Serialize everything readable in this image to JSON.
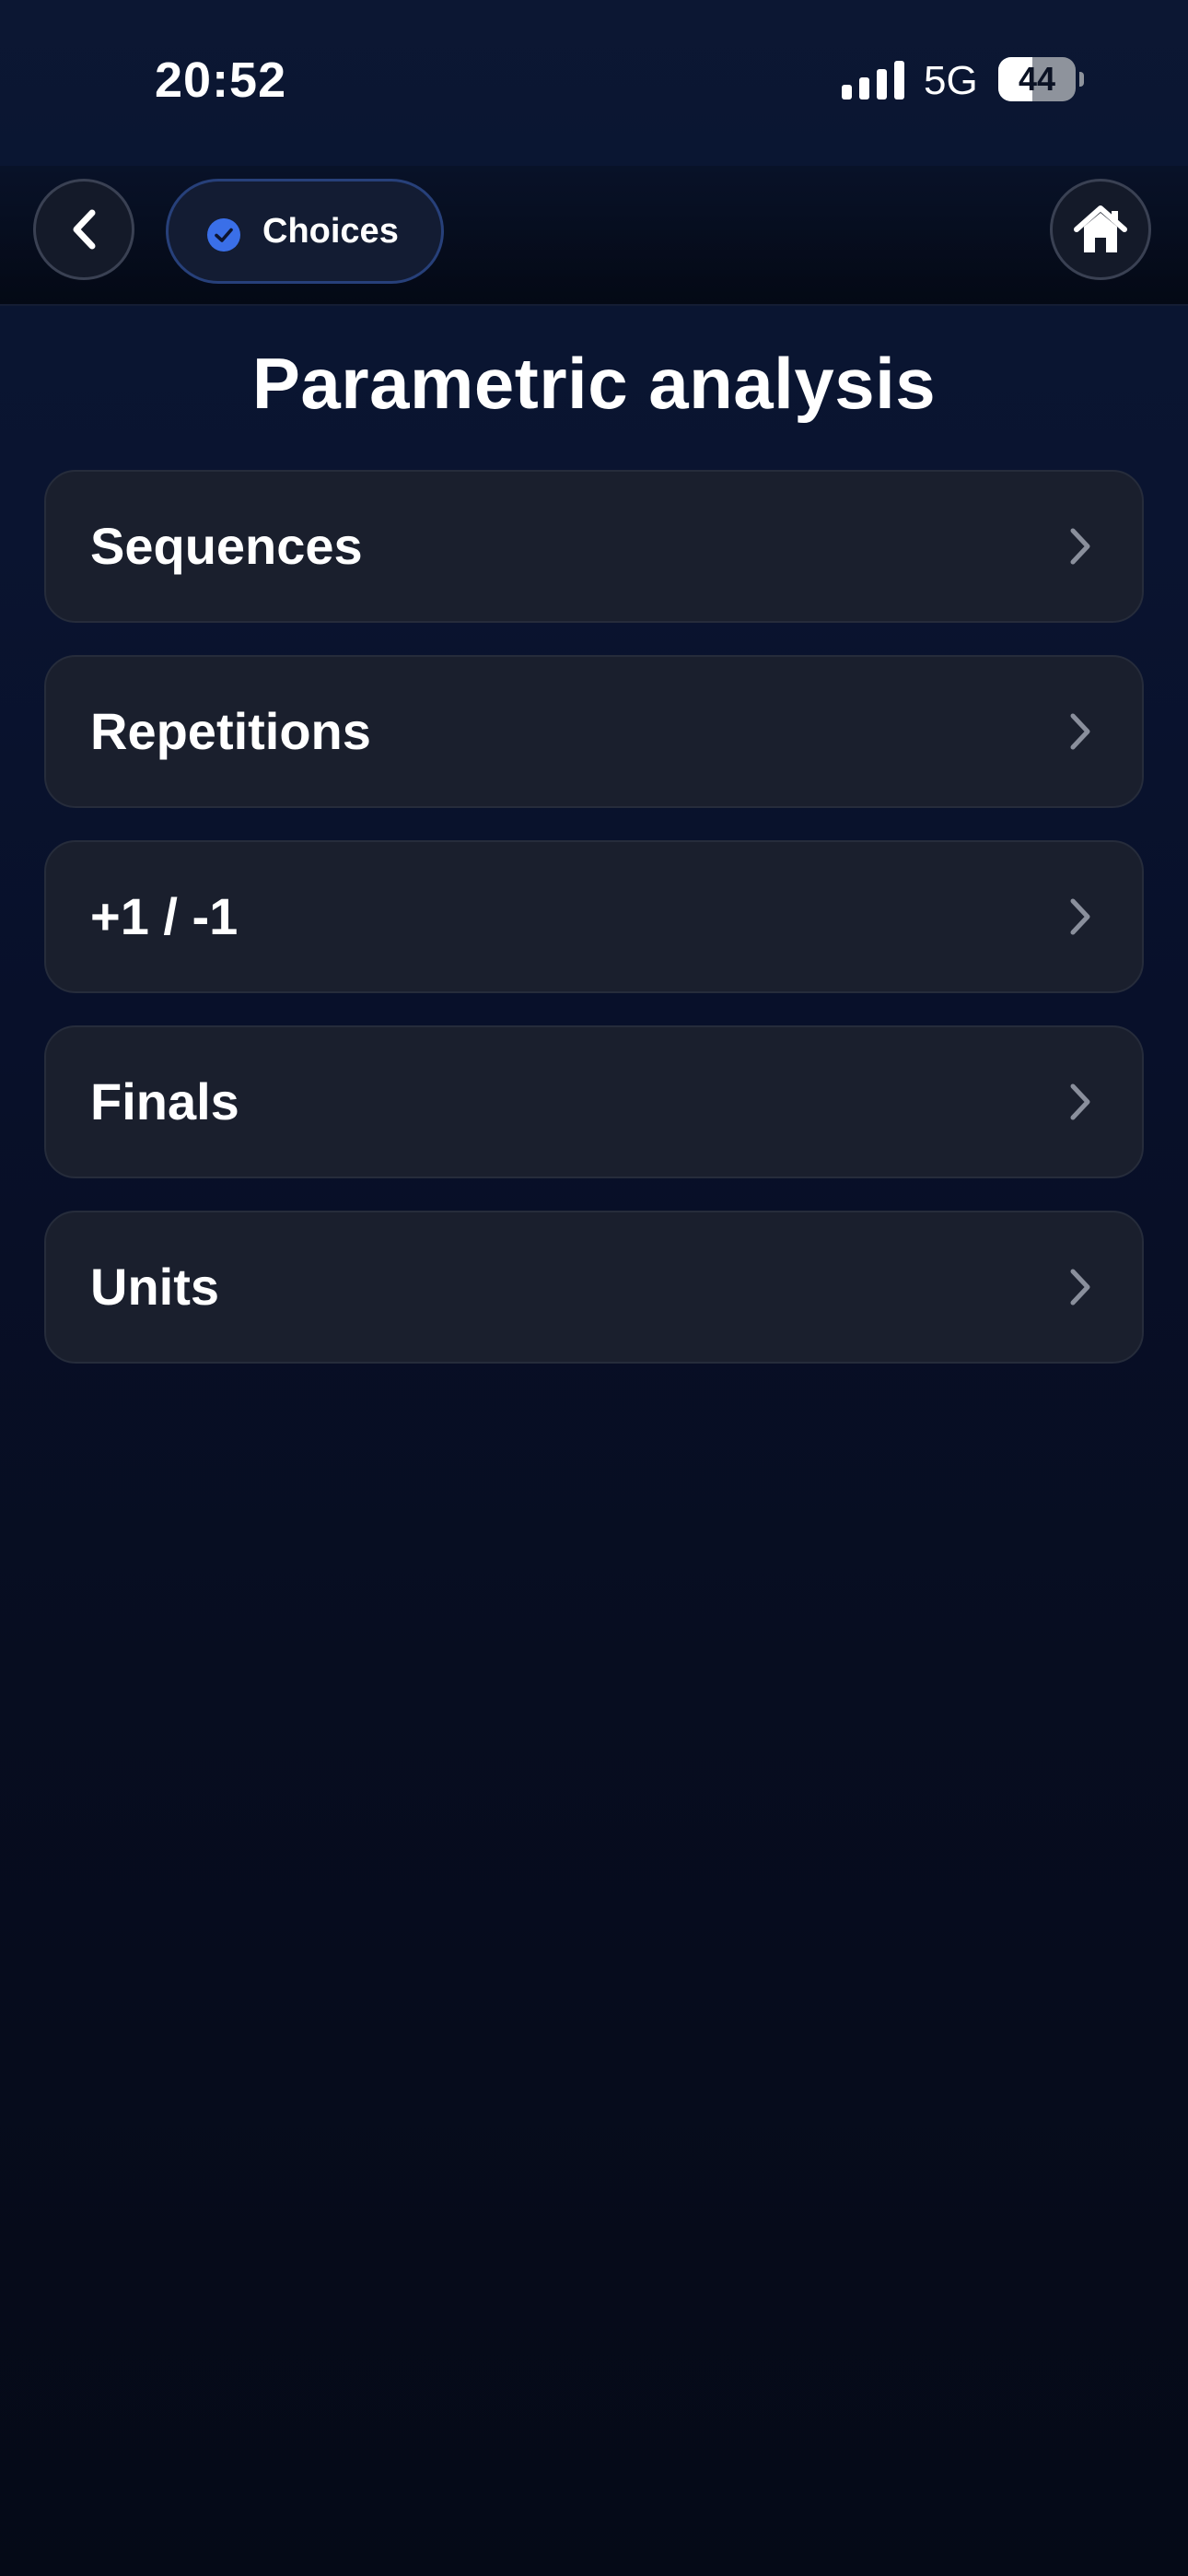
{
  "status_bar": {
    "time": "20:52",
    "network": "5G",
    "battery_level": "44",
    "battery_fraction": 0.44,
    "signal_icon": "signal-bars-icon"
  },
  "nav": {
    "back_icon": "chevron-left-icon",
    "choices_label": "Choices",
    "choices_icon": "check-circle-icon",
    "home_icon": "home-icon"
  },
  "page": {
    "title": "Parametric analysis"
  },
  "menu": {
    "items": [
      {
        "label": "Sequences"
      },
      {
        "label": "Repetitions"
      },
      {
        "label": "+1 / -1"
      },
      {
        "label": "Finals"
      },
      {
        "label": "Units"
      }
    ],
    "chevron_icon": "chevron-right-icon"
  },
  "colors": {
    "accent_blue": "#3a6fe8",
    "card_background": "#1a1f2d",
    "background_top": "#0c1733",
    "background_bottom": "#050a17"
  }
}
